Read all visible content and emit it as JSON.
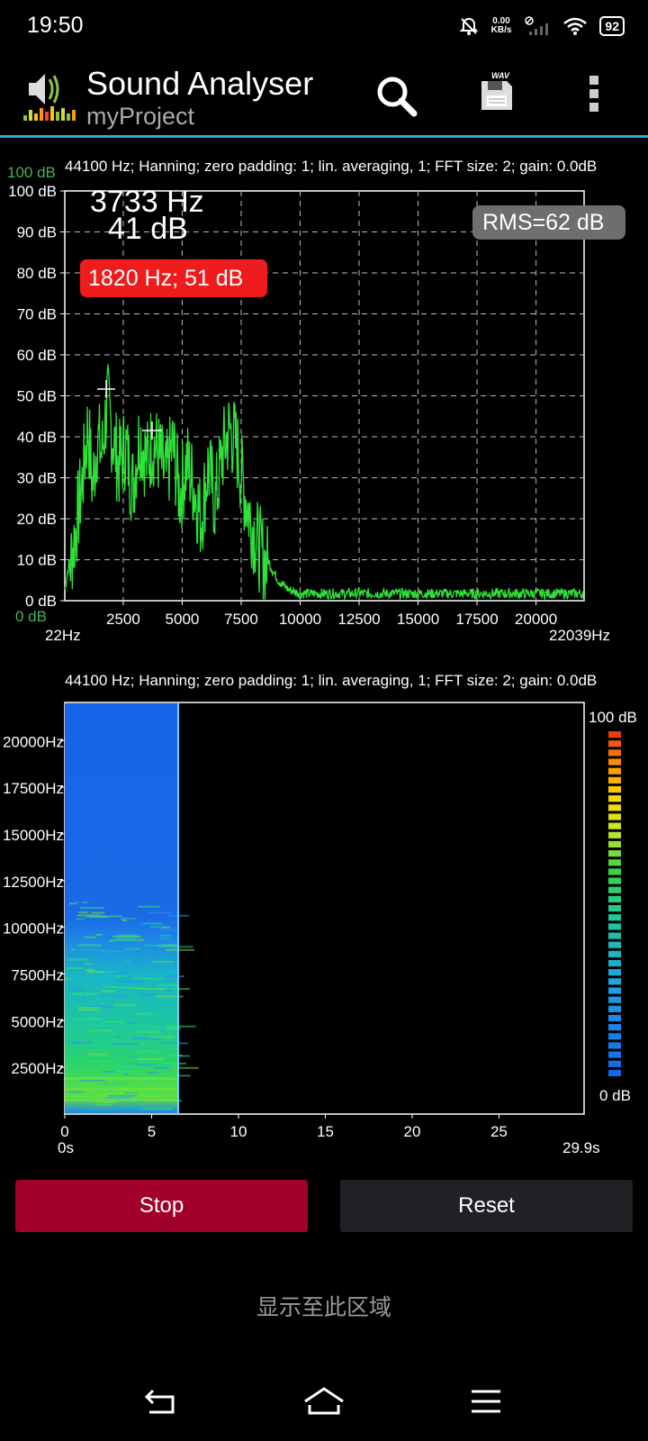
{
  "status_bar": {
    "time": "19:50",
    "net_speed_value": "0.00",
    "net_speed_unit": "KB/s",
    "battery": "92",
    "icons": [
      "notifications-off-icon",
      "no-sim-signal-icon",
      "wifi-icon",
      "battery-icon"
    ]
  },
  "app_bar": {
    "title": "Sound Analyser",
    "subtitle": "myProject",
    "icons": [
      "app-logo-icon",
      "search-icon",
      "save-wav-icon",
      "overflow-menu-icon"
    ],
    "wav_badge": "WAV"
  },
  "spectrum": {
    "info": "44100 Hz; Hanning; zero padding: 1; lin. averaging, 1; FFT size: 2; gain: 0.0dB",
    "y_top_green": "100 dB",
    "y_bottom_green": "0 dB",
    "cursor_freq": "3733 Hz",
    "cursor_level": "41 dB",
    "peak_label": "1820 Hz; 51 dB",
    "rms_label": "RMS=62 dB",
    "x_min_label": "22Hz",
    "x_max_label": "22039Hz",
    "y_ticks": [
      "100 dB",
      "90 dB",
      "80 dB",
      "70 dB",
      "60 dB",
      "50 dB",
      "40 dB",
      "30 dB",
      "20 dB",
      "10 dB",
      "0 dB"
    ],
    "x_ticks": [
      "2500",
      "5000",
      "7500",
      "10000",
      "12500",
      "15000",
      "17500",
      "20000"
    ]
  },
  "spectrogram": {
    "info": "44100 Hz; Hanning; zero padding: 1; lin. averaging, 1; FFT size: 2; gain: 0.0dB",
    "y_ticks": [
      "20000Hz",
      "17500Hz",
      "15000Hz",
      "12500Hz",
      "10000Hz",
      "7500Hz",
      "5000Hz",
      "2500Hz"
    ],
    "x_ticks": [
      "0",
      "5",
      "10",
      "15",
      "20",
      "25"
    ],
    "x_min_label": "0s",
    "x_max_label": "29.9s",
    "scale_max": "100 dB",
    "scale_min": "0 dB"
  },
  "controls": {
    "stop_label": "Stop",
    "reset_label": "Reset"
  },
  "bottom_text": "显示至此区域",
  "nav_icons": [
    "back-icon",
    "home-icon",
    "menu-icon"
  ],
  "chart_data": {
    "type": "line",
    "xlabel": "",
    "ylabel": "",
    "xlim": [
      22,
      22039
    ],
    "ylim": [
      0,
      100
    ],
    "grid": true,
    "series": [
      {
        "x": [
          22,
          500,
          800,
          1000,
          1200,
          1400,
          1600,
          1820,
          2000,
          2300,
          2600,
          2900,
          3200,
          3500,
          3733,
          4000,
          4300,
          4600,
          4900,
          5200,
          5500,
          5800,
          6100,
          6400,
          6700,
          7000,
          7300,
          7600,
          7900,
          8200,
          8500,
          8800,
          9100,
          9500,
          10000,
          11000,
          12000,
          13000,
          14000,
          15000,
          16000,
          17000,
          18000,
          19000,
          20000,
          21000,
          22039
        ],
        "values": [
          3,
          20,
          33,
          45,
          30,
          42,
          38,
          51,
          44,
          35,
          40,
          30,
          43,
          36,
          41,
          38,
          32,
          40,
          28,
          36,
          30,
          22,
          35,
          26,
          38,
          44,
          40,
          30,
          22,
          16,
          12,
          8,
          5,
          3,
          2,
          2,
          2,
          2,
          2,
          2,
          2,
          2,
          2,
          2,
          2,
          2,
          2
        ]
      }
    ]
  }
}
